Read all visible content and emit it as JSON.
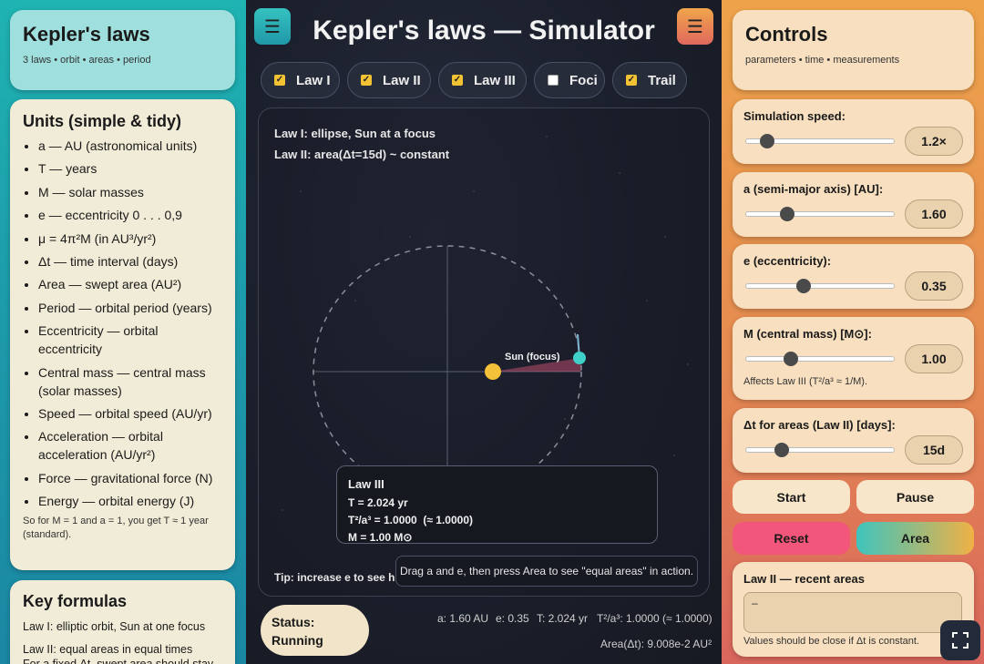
{
  "left": {
    "title": "Kepler's laws",
    "subtitle": "3 laws • orbit • areas • period",
    "units": {
      "heading": "Units (simple & tidy)",
      "items": [
        "a — AU (astronomical units)",
        "T — years",
        "M — solar masses",
        "e — eccentricity 0 . . . 0,9",
        "μ = 4π²M (in AU³/yr²)",
        "Δt — time interval (days)",
        "Area — swept area (AU²)",
        "Period — orbital period (years)",
        "Eccentricity — orbital eccentricity",
        "Central mass — central mass (solar masses)",
        "Speed — orbital speed (AU/yr)",
        "Acceleration — orbital acceleration (AU/yr²)",
        "Force — gravitational force (N)",
        "Energy — orbital energy (J)"
      ],
      "note": "So for M = 1 and a = 1, you get T ≈ 1 year (standard)."
    },
    "formulas": {
      "heading": "Key formulas",
      "line1": "Law I: elliptic orbit, Sun at one focus",
      "line2": "Law II: equal areas in equal times",
      "line3": "For a fixed Δt, swept area should stay"
    }
  },
  "center": {
    "title": "Kepler's laws — Simulator",
    "toggles": [
      {
        "label": "Law I",
        "checked": true
      },
      {
        "label": "Law II",
        "checked": true
      },
      {
        "label": "Law III",
        "checked": true
      },
      {
        "label": "Foci",
        "checked": false
      },
      {
        "label": "Trail",
        "checked": true
      }
    ],
    "law1_text": "Law I: ellipse, Sun at a focus",
    "law2_text": "Law II: area(Δt=15d) ~ constant",
    "sun_label": "Sun (focus)",
    "law3": {
      "title": "Law III",
      "t_line": "T = 2.024 yr",
      "ratio_line": "T²/a³ = 1.0000  (≈ 1.0000)",
      "m_line": "M = 1.00 M⊙"
    },
    "tip": "Tip: increase e to see hi",
    "tooltip": "Drag a and e, then press Area to see \"equal areas\" in action.",
    "status": {
      "label": "Status:",
      "value": "Running"
    },
    "measurements": {
      "a": "a: 1.60 AU",
      "e": "e: 0.35",
      "t": "T: 2.024 yr",
      "ratio": "T²/a³: 1.0000 (≈ 1.0000)",
      "area": "Area(Δt): 9.008e-2 AU²"
    },
    "colors": {
      "sun": "#f4c23a",
      "planet": "#3fd0c9",
      "sector": "#d9567a"
    }
  },
  "right": {
    "title": "Controls",
    "subtitle": "parameters • time • measurements",
    "speed": {
      "label": "Simulation speed:",
      "value": "1.2×",
      "fraction": 0.14
    },
    "a": {
      "label": "a (semi-major axis) [AU]:",
      "value": "1.60",
      "fraction": 0.28
    },
    "e": {
      "label": "e (eccentricity):",
      "value": "0.35",
      "fraction": 0.39
    },
    "m": {
      "label": "M (central mass) [M⊙]:",
      "value": "1.00",
      "fraction": 0.3,
      "note": "Affects Law III (T²/a³ ≈ 1/M)."
    },
    "dt": {
      "label": "Δt for areas (Law II) [days]:",
      "value": "15d",
      "fraction": 0.24
    },
    "buttons": {
      "start": "Start",
      "pause": "Pause",
      "reset": "Reset",
      "area": "Area"
    },
    "recent": {
      "title": "Law II — recent areas",
      "value": "–",
      "note": "Values should be close if Δt is constant."
    }
  }
}
